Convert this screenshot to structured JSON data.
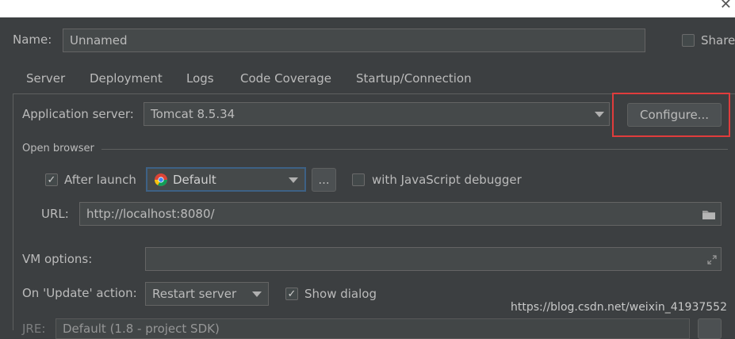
{
  "window": {
    "close_glyph": "✕"
  },
  "name_row": {
    "label": "Name:",
    "value": "Unnamed",
    "share_label": "Share"
  },
  "tabs": [
    {
      "label": "Server"
    },
    {
      "label": "Deployment"
    },
    {
      "label": "Logs"
    },
    {
      "label": "Code Coverage"
    },
    {
      "label": "Startup/Connection"
    }
  ],
  "server": {
    "app_server_label": "Application server:",
    "app_server_value": "Tomcat 8.5.34",
    "configure_label": "Configure..."
  },
  "browser": {
    "section_label": "Open browser",
    "after_launch_label": "After launch",
    "after_launch_checked": true,
    "browser_value": "Default",
    "more_label": "...",
    "js_debugger_label": "with JavaScript debugger",
    "js_debugger_checked": false,
    "url_label": "URL:",
    "url_value": "http://localhost:8080/"
  },
  "vm": {
    "label": "VM options:",
    "value": ""
  },
  "update": {
    "label": "On 'Update' action:",
    "value": "Restart server",
    "show_dialog_label": "Show dialog",
    "show_dialog_checked": true
  },
  "bottom_row": {
    "partial_label": "JRE:",
    "partial_value": "Default (1.8 - project SDK)"
  },
  "watermark": "https://blog.csdn.net/weixin_41937552",
  "colors": {
    "highlight": "#e03c3c",
    "background": "#3c3f41",
    "field": "#45494a"
  }
}
